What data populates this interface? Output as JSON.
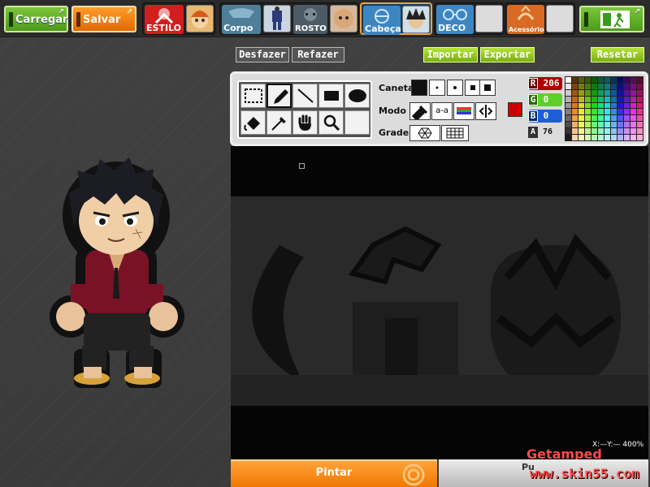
{
  "topbar": {
    "load_label": "Carregar",
    "save_label": "Salvar",
    "style_label": "ESTILO",
    "tabs": [
      {
        "label": "Corpo"
      },
      {
        "label": "ROSTO"
      },
      {
        "label": "Cabeça"
      },
      {
        "label": "DECO"
      },
      {
        "label": "Acessórios"
      }
    ]
  },
  "actions": {
    "undo": "Desfazer",
    "redo": "Refazer",
    "import": "Importar",
    "export": "Exportar",
    "reset": "Resetar"
  },
  "tools": [
    "select",
    "pencil",
    "line",
    "rectangle",
    "ellipse",
    "fill",
    "eyedropper",
    "hand",
    "zoom",
    "empty"
  ],
  "panel": {
    "pen_label": "Caneta",
    "mode_label": "Modo",
    "grid_label": "Grade",
    "mode_text": "a-a",
    "color": {
      "r_label": "R",
      "r_value": "206",
      "g_label": "G",
      "g_value": "0",
      "b_label": "B",
      "b_value": "0",
      "a_label": "A",
      "a_value": "76",
      "current": "#ce0000"
    }
  },
  "status": {
    "zoom": "X:—Y:— 400%"
  },
  "bottom": {
    "paint_label": "Pintar",
    "publish_label": "Pu"
  },
  "watermark": {
    "line1": "Getamped Forum",
    "line2": "www.skin55.com"
  },
  "colors": {
    "accent_green": "#7bc63a",
    "accent_orange": "#f07800",
    "lime": "#9ad01e"
  }
}
